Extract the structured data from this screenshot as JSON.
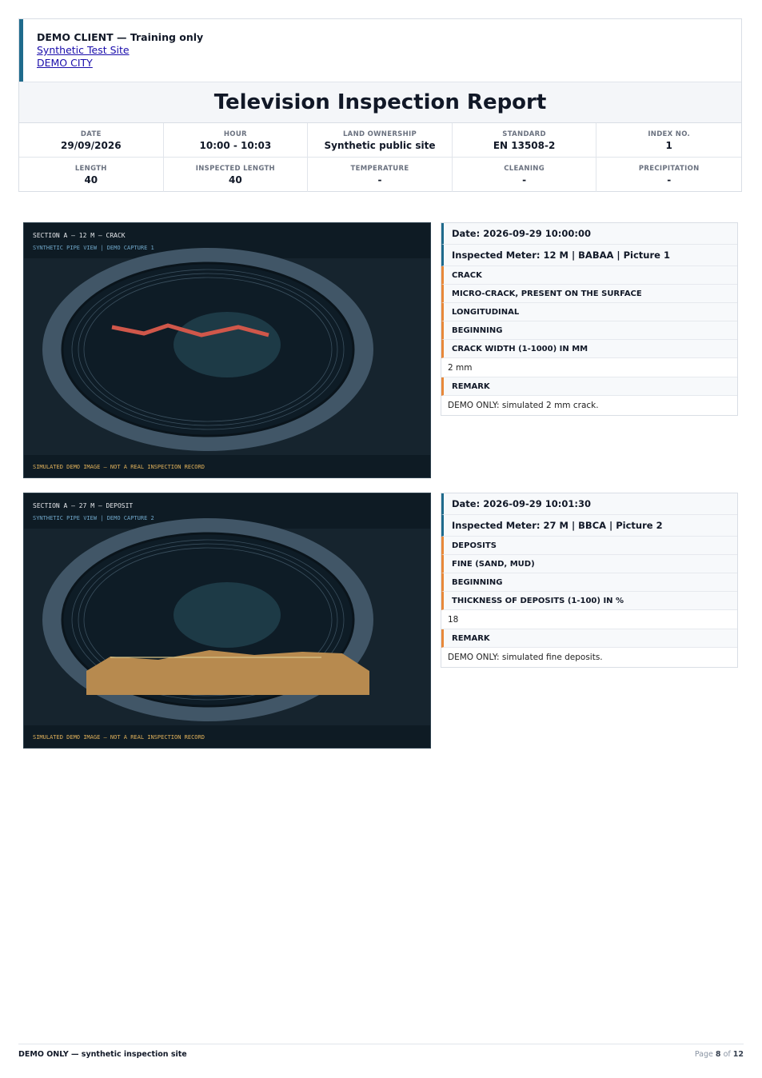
{
  "header": {
    "client": "DEMO CLIENT — Training only",
    "site": "Synthetic Test Site",
    "city": "DEMO CITY",
    "title": "Television Inspection Report"
  },
  "meta": [
    {
      "label": "DATE",
      "value": "29/09/2026"
    },
    {
      "label": "HOUR",
      "value": "10:00 - 10:03"
    },
    {
      "label": "LAND OWNERSHIP",
      "value": "Synthetic public site"
    },
    {
      "label": "STANDARD",
      "value": "EN 13508-2"
    },
    {
      "label": "INDEX NO.",
      "value": "1"
    },
    {
      "label": "LENGTH",
      "value": "40"
    },
    {
      "label": "INSPECTED LENGTH",
      "value": "40"
    },
    {
      "label": "TEMPERATURE",
      "value": "-"
    },
    {
      "label": "CLEANING",
      "value": "-"
    },
    {
      "label": "PRECIPITATION",
      "value": "-"
    }
  ],
  "observations": [
    {
      "image": {
        "caption_top": "SECTION A – 12 M – CRACK",
        "caption_sub": "SYNTHETIC PIPE VIEW  |  DEMO CAPTURE 1",
        "caption_bottom": "SIMULATED DEMO IMAGE – NOT A REAL INSPECTION RECORD",
        "defect": "crack"
      },
      "date": "Date: 2026-09-29 10:00:00",
      "meter": "Inspected Meter: 12 M | BABAA | Picture 1",
      "rows": [
        {
          "kind": "tag",
          "text": "CRACK"
        },
        {
          "kind": "tag",
          "text": "MICRO-CRACK, PRESENT ON THE SURFACE"
        },
        {
          "kind": "tag",
          "text": "LONGITUDINAL"
        },
        {
          "kind": "tag",
          "text": "BEGINNING"
        },
        {
          "kind": "tag",
          "text": "CRACK WIDTH (1-1000) IN MM"
        },
        {
          "kind": "val",
          "text": "2 mm"
        },
        {
          "kind": "tag",
          "text": "REMARK"
        },
        {
          "kind": "val",
          "text": "DEMO ONLY: simulated 2 mm crack."
        }
      ]
    },
    {
      "image": {
        "caption_top": "SECTION A – 27 M – DEPOSIT",
        "caption_sub": "SYNTHETIC PIPE VIEW  |  DEMO CAPTURE 2",
        "caption_bottom": "SIMULATED DEMO IMAGE – NOT A REAL INSPECTION RECORD",
        "defect": "deposit"
      },
      "date": "Date: 2026-09-29 10:01:30",
      "meter": "Inspected Meter: 27 M | BBCA | Picture 2",
      "rows": [
        {
          "kind": "tag",
          "text": "DEPOSITS"
        },
        {
          "kind": "tag",
          "text": "FINE (SAND, MUD)"
        },
        {
          "kind": "tag",
          "text": "BEGINNING"
        },
        {
          "kind": "tag",
          "text": "THICKNESS OF DEPOSITS (1-100) IN %"
        },
        {
          "kind": "val",
          "text": "18"
        },
        {
          "kind": "tag",
          "text": "REMARK"
        },
        {
          "kind": "val",
          "text": "DEMO ONLY: simulated fine deposits."
        }
      ]
    }
  ],
  "footer": {
    "left": "DEMO ONLY — synthetic inspection site",
    "page_prefix": "Page",
    "page_current": "8",
    "page_of": "of",
    "page_total": "12"
  },
  "colors": {
    "accent_blue": "#1f6b8c",
    "accent_orange": "#e8883a",
    "crack": "#d0574a",
    "deposit": "#b78a4f"
  }
}
